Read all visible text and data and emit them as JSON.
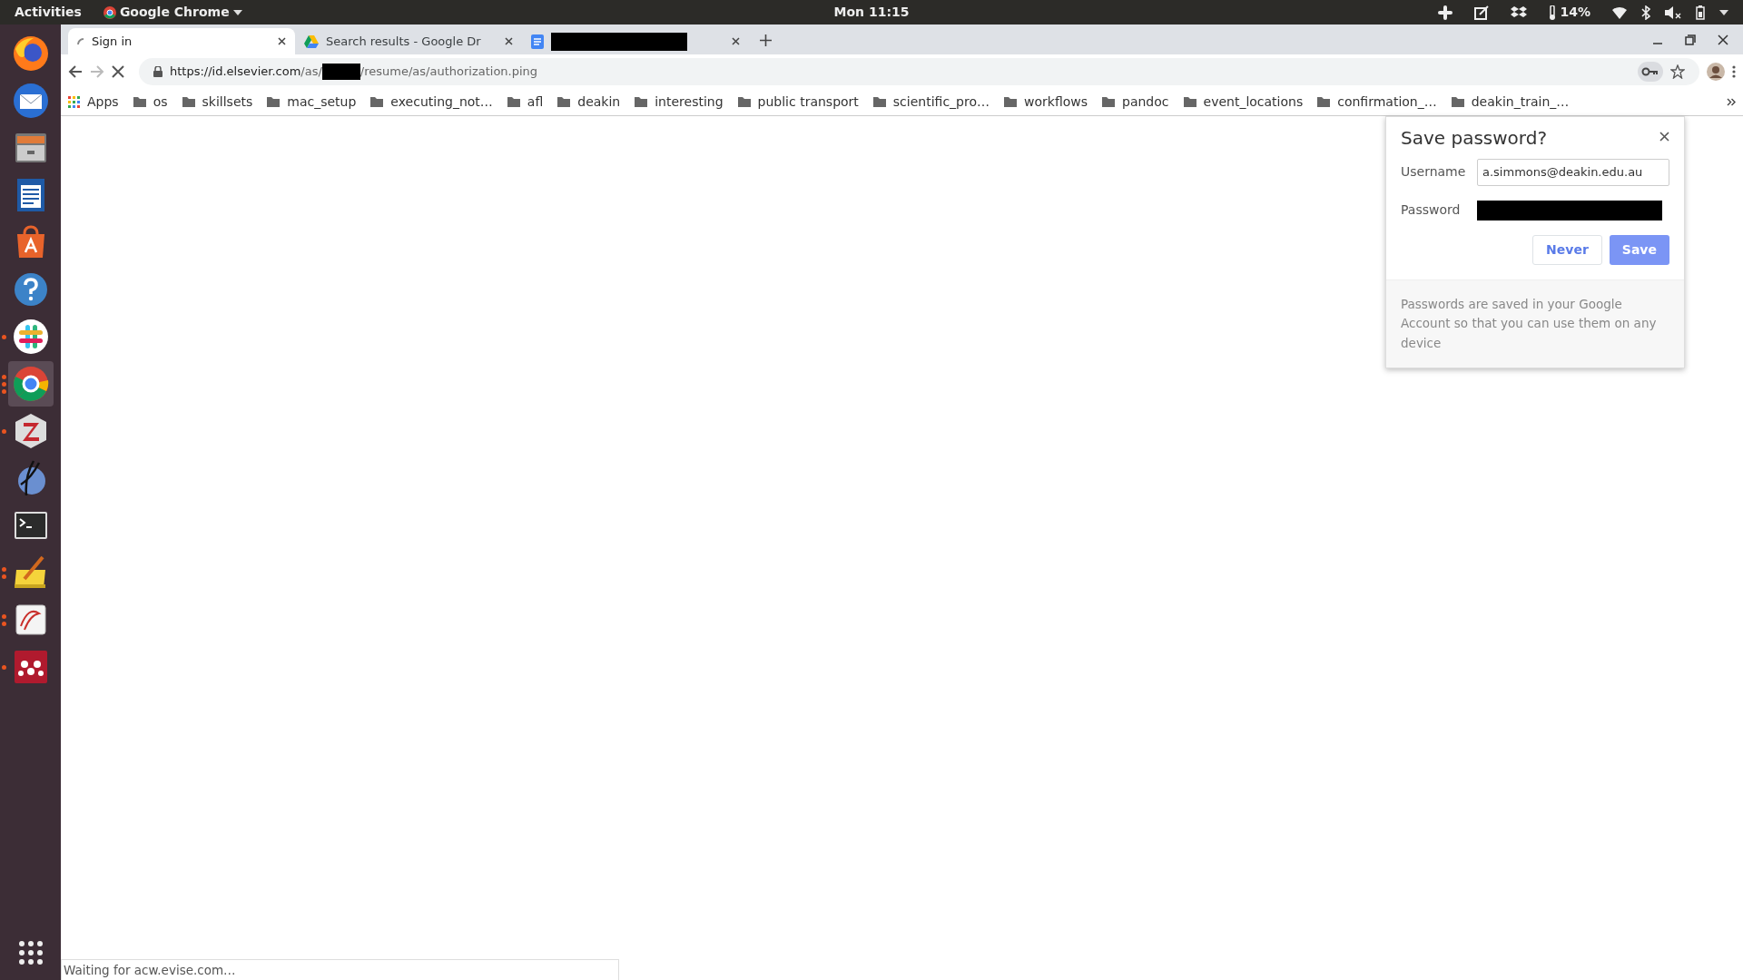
{
  "top_bar": {
    "activities": "Activities",
    "app_menu": "Google Chrome",
    "clock": "Mon 11:15",
    "temperature": "14%"
  },
  "dock": {
    "items": [
      {
        "kind": "firefox",
        "selected": false
      },
      {
        "kind": "mail",
        "selected": false
      },
      {
        "kind": "files",
        "selected": false
      },
      {
        "kind": "writer",
        "selected": false
      },
      {
        "kind": "store",
        "selected": false
      },
      {
        "kind": "help",
        "selected": false
      },
      {
        "kind": "chat",
        "running": true,
        "multiple": false,
        "selected": false
      },
      {
        "kind": "chrome",
        "running": true,
        "multiple": true,
        "selected": true
      },
      {
        "kind": "zotero",
        "running": true,
        "multiple": false,
        "selected": false
      },
      {
        "kind": "sphere",
        "selected": false
      },
      {
        "kind": "terminal",
        "selected": false
      },
      {
        "kind": "notes",
        "running": true,
        "multiple": true,
        "selected": false
      },
      {
        "kind": "reader",
        "running": true,
        "multiple": true,
        "selected": false
      },
      {
        "kind": "network",
        "running": true,
        "multiple": false,
        "selected": false
      }
    ]
  },
  "tabs": [
    {
      "kind": "loading",
      "title": "Sign in",
      "selected": true
    },
    {
      "kind": "drive",
      "title": "Search results - Google Dr",
      "selected": false
    },
    {
      "kind": "redacted",
      "selected": false
    }
  ],
  "toolbar": {
    "back_disabled": false,
    "forward_disabled": true,
    "loading": true,
    "url_host": "https://id.elsevier.com",
    "url_before": "/as/",
    "url_after": "/resume/as/authorization.ping"
  },
  "bookmarks": [
    {
      "kind": "apps",
      "label": "Apps"
    },
    {
      "kind": "folder",
      "label": "os"
    },
    {
      "kind": "folder",
      "label": "skillsets"
    },
    {
      "kind": "folder",
      "label": "mac_setup"
    },
    {
      "kind": "folder",
      "label": "executing_not…"
    },
    {
      "kind": "folder",
      "label": "afl"
    },
    {
      "kind": "folder",
      "label": "deakin"
    },
    {
      "kind": "folder",
      "label": "interesting"
    },
    {
      "kind": "folder",
      "label": "public transport"
    },
    {
      "kind": "folder",
      "label": "scientific_pro…"
    },
    {
      "kind": "folder",
      "label": "workflows"
    },
    {
      "kind": "folder",
      "label": "pandoc"
    },
    {
      "kind": "folder",
      "label": "event_locations"
    },
    {
      "kind": "folder",
      "label": "confirmation_…"
    },
    {
      "kind": "folder",
      "label": "deakin_train_…"
    }
  ],
  "save_password": {
    "title": "Save password?",
    "username_label": "Username",
    "username": "a.simmons@deakin.edu.au",
    "password_label": "Password",
    "buttons": [
      {
        "kind": "secondary",
        "label": "Never"
      },
      {
        "kind": "primary",
        "label": "Save"
      }
    ],
    "footer": "Passwords are saved in your Google Account so that you can use them on any device"
  },
  "status_bar": "Waiting for acw.evise.com…"
}
